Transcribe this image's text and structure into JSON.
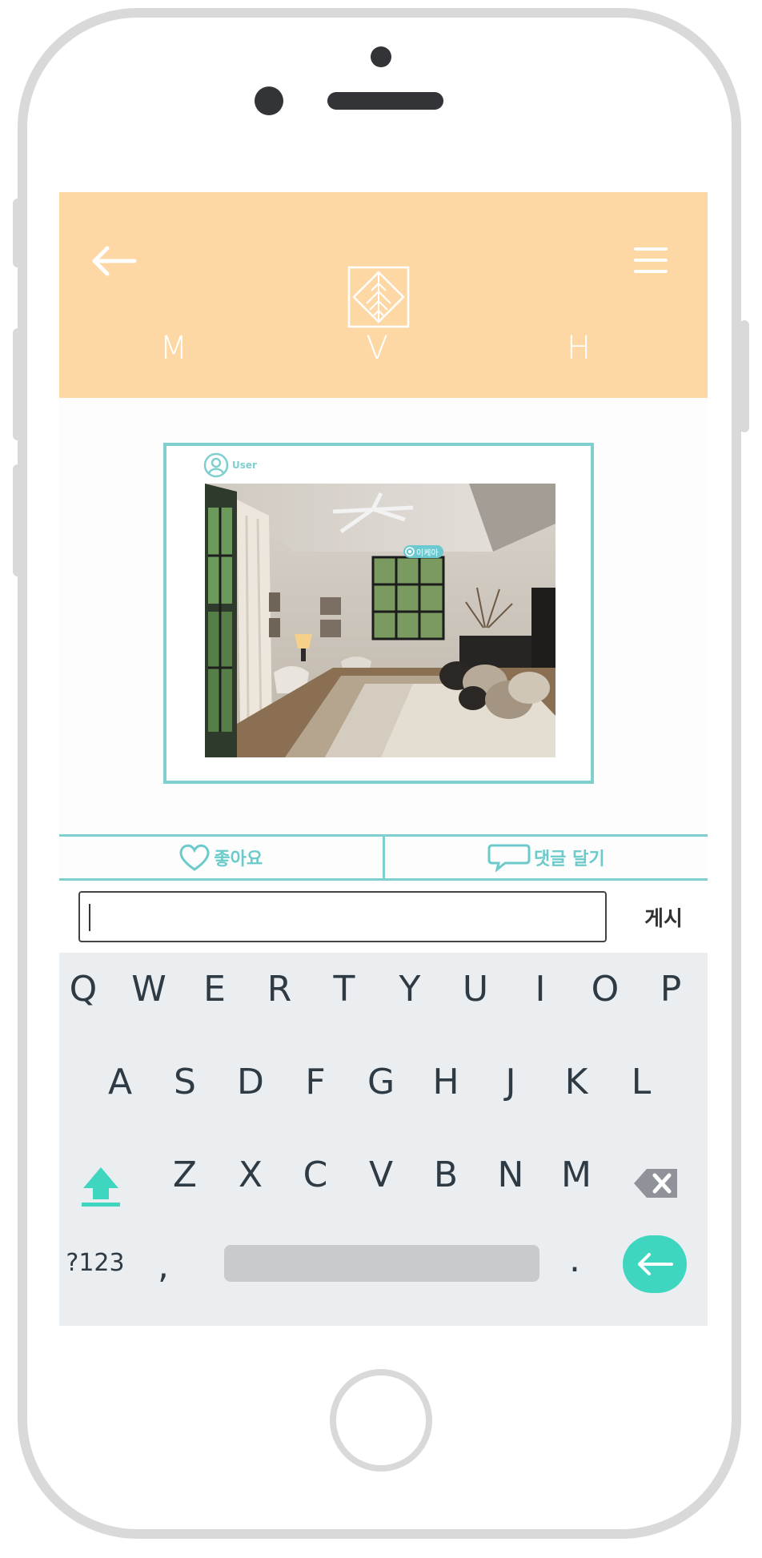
{
  "header": {
    "back_icon": "arrow-left-icon",
    "menu_icon": "hamburger-icon",
    "logo_icon": "leaf-diamond-logo",
    "nav_letters": [
      "M",
      "V",
      "H"
    ]
  },
  "post": {
    "user_label": "User",
    "photo_description_icon": "bedroom-photo",
    "tag_label": "이케아"
  },
  "actions": {
    "like_label": "좋아요",
    "comment_label": "댓글 달기"
  },
  "comment": {
    "input_value": "",
    "post_label": "게시"
  },
  "keyboard": {
    "row1": [
      "Q",
      "W",
      "E",
      "R",
      "T",
      "Y",
      "U",
      "I",
      "O",
      "P"
    ],
    "row2": [
      "A",
      "S",
      "D",
      "F",
      "G",
      "H",
      "J",
      "K",
      "L"
    ],
    "row3": [
      "Z",
      "X",
      "C",
      "V",
      "B",
      "N",
      "M"
    ],
    "symbols_label": "?123",
    "comma": ",",
    "period": "."
  },
  "colors": {
    "header_bg": "#fdd8a5",
    "accent_teal": "#7fcfcf",
    "enter_key": "#3fd6c0"
  }
}
